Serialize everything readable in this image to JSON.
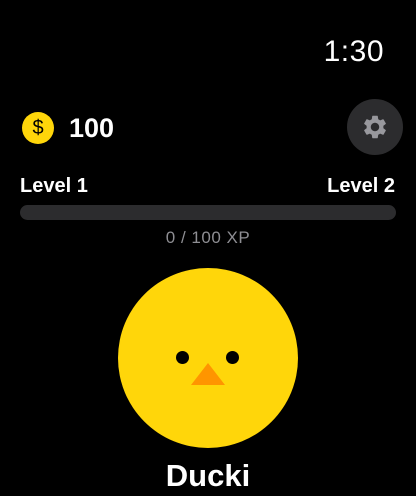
{
  "status_bar": {
    "time": "1:30"
  },
  "currency": {
    "icon": "dollar-coin-icon",
    "symbol": "$",
    "amount": "100",
    "coin_color": "#FFD60A"
  },
  "settings": {
    "icon": "gear-icon"
  },
  "level": {
    "current_label": "Level 1",
    "next_label": "Level 2",
    "progress_fraction": 0,
    "xp_text": "0 / 100 XP",
    "track_color": "#2C2C2E"
  },
  "pet": {
    "name": "Ducki",
    "body_color": "#FFD60A",
    "beak_color": "#FF9500"
  }
}
